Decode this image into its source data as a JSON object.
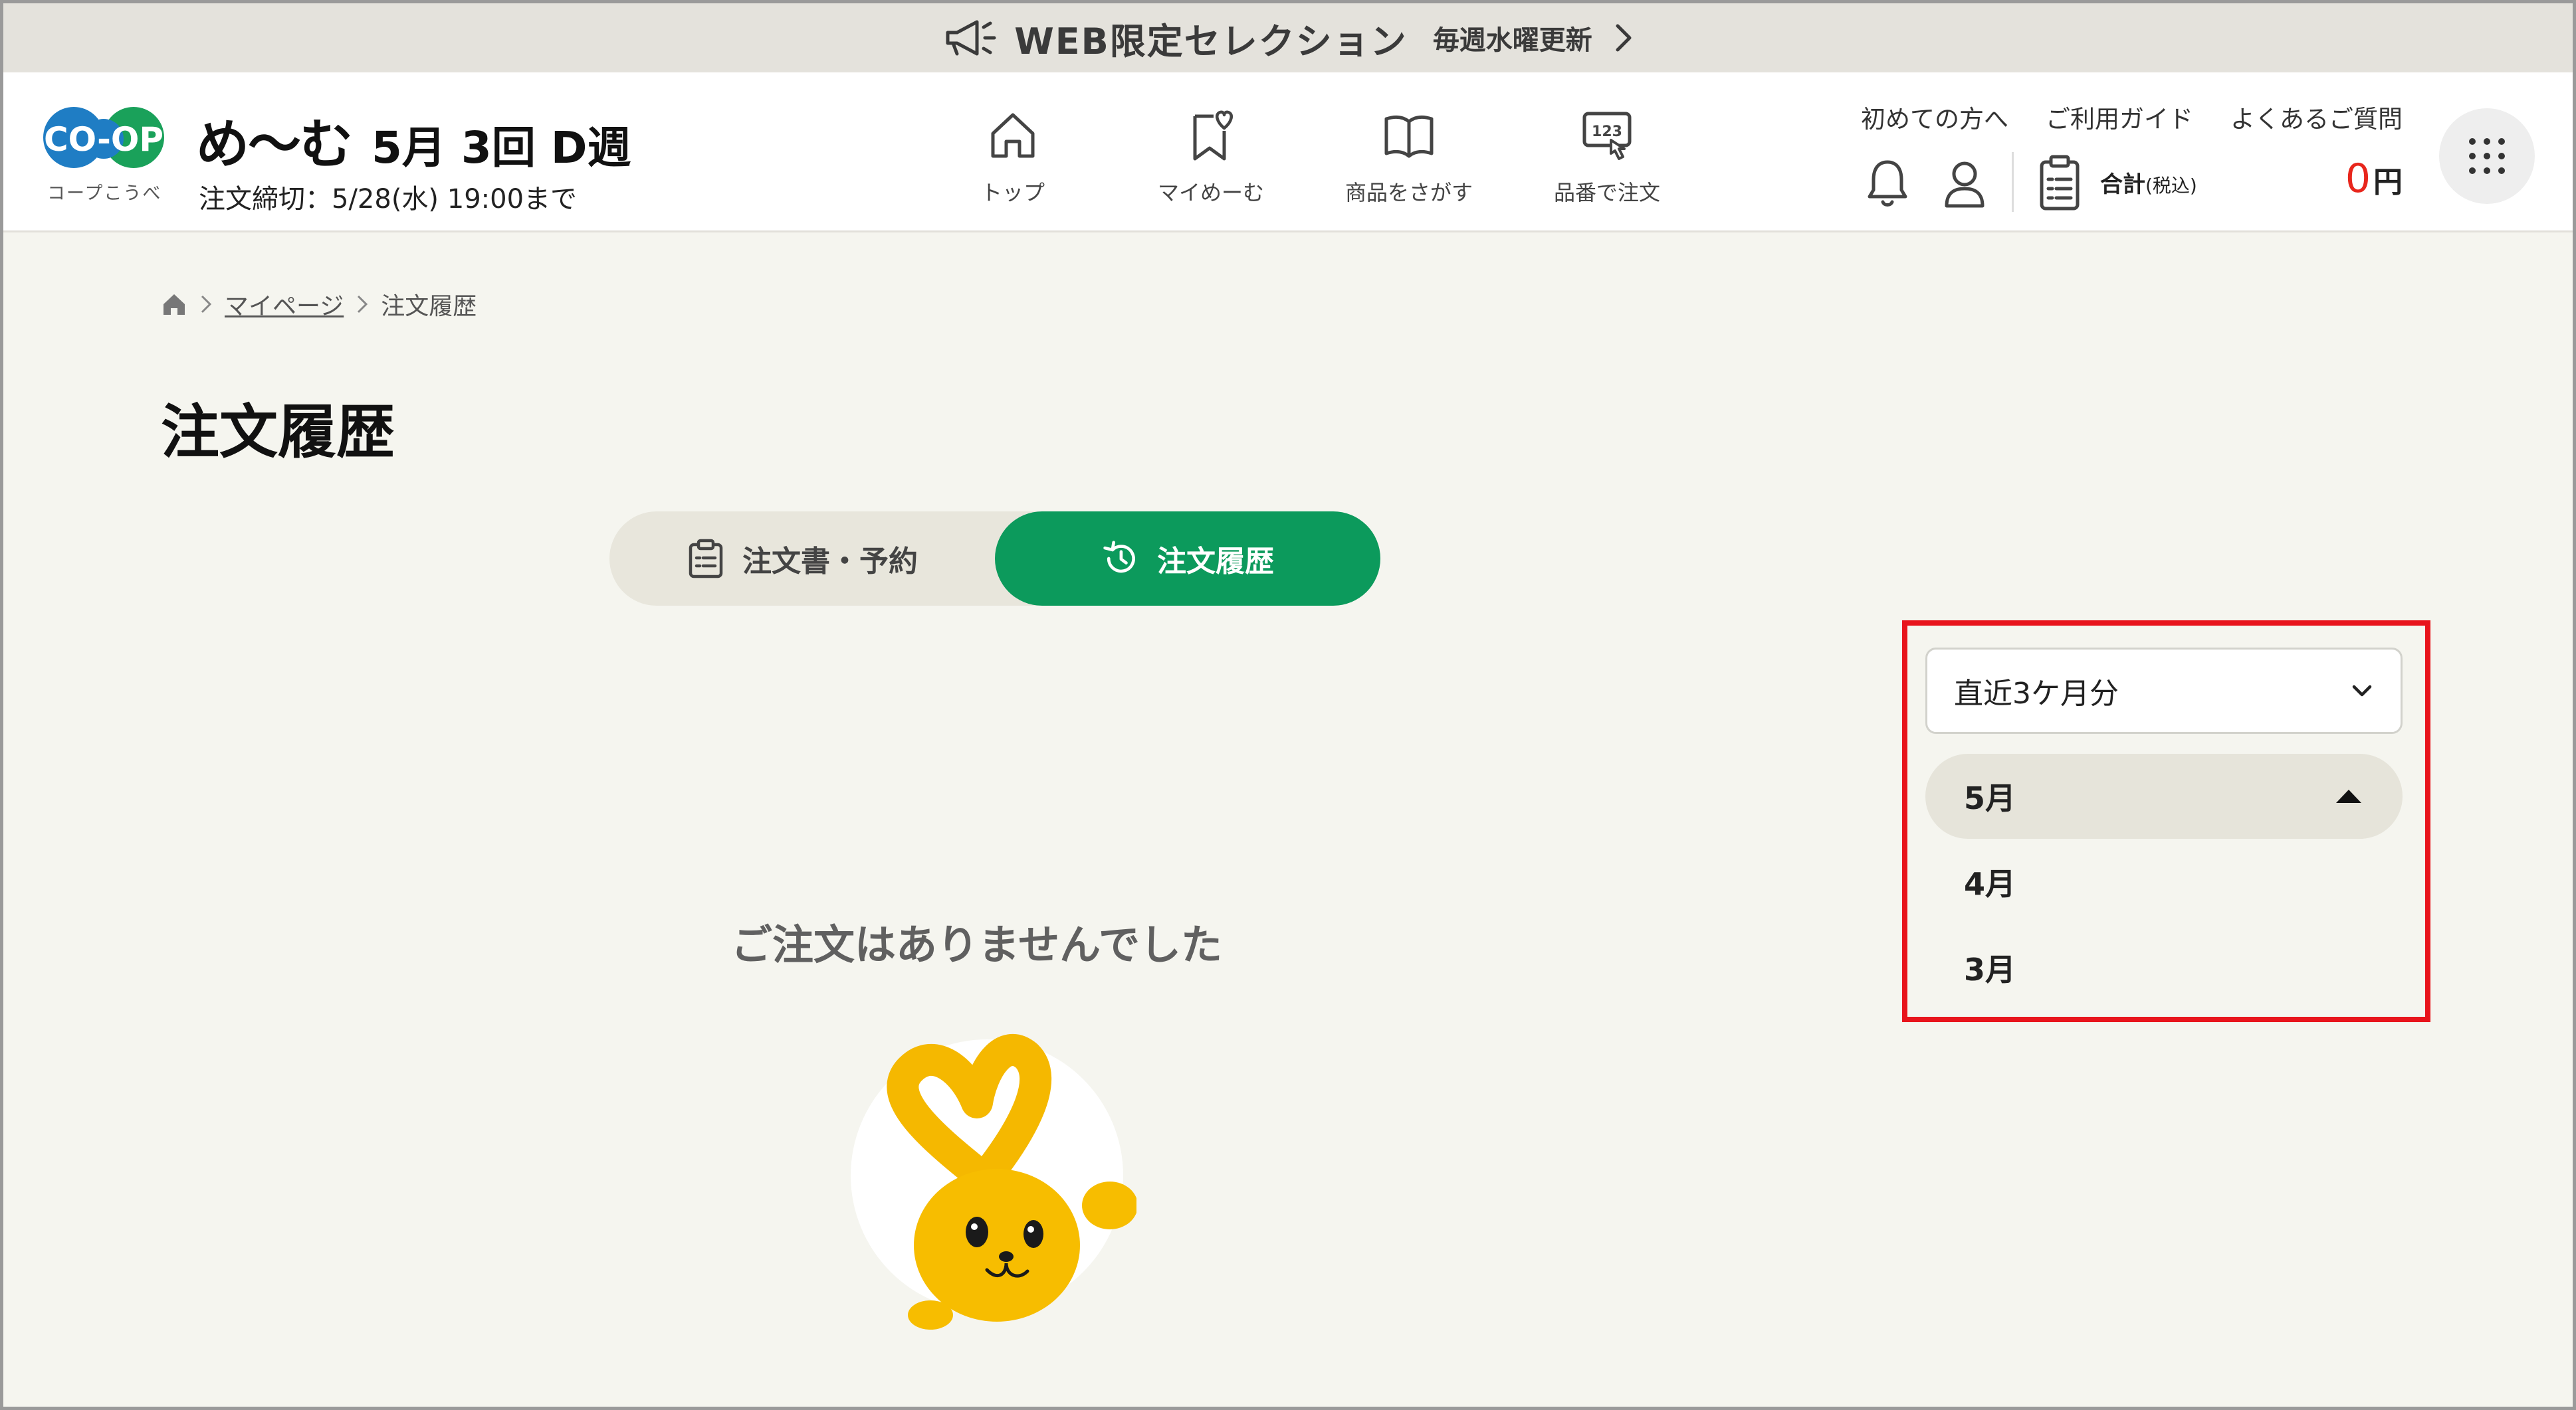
{
  "promo": {
    "title": "WEB限定セレクション",
    "subtitle": "毎週水曜更新"
  },
  "header": {
    "logo_text": "CO-OP",
    "logo_sub": "コープこうべ",
    "brand_name": "め〜む",
    "week_info": "5月 3回 D週",
    "deadline": "注文締切：5/28(水) 19:00まで",
    "nav": [
      {
        "label": "トップ",
        "icon": "home-icon"
      },
      {
        "label": "マイめーむ",
        "icon": "bookmark-heart-icon"
      },
      {
        "label": "商品をさがす",
        "icon": "book-icon"
      },
      {
        "label": "品番で注文",
        "icon": "number-touch-icon"
      }
    ],
    "links": [
      "初めての方へ",
      "ご利用ガイド",
      "よくあるご質問"
    ],
    "total_label": "合計",
    "total_tax": "(税込)",
    "total_value": "0",
    "total_unit": "円"
  },
  "breadcrumb": {
    "items": [
      "マイページ",
      "注文履歴"
    ]
  },
  "page_title": "注文履歴",
  "tabs": [
    {
      "label": "注文書・予約",
      "active": false
    },
    {
      "label": "注文履歴",
      "active": true
    }
  ],
  "filter": {
    "selected": "直近3ケ月分",
    "options": [
      {
        "label": "5月",
        "expanded": true
      },
      {
        "label": "4月",
        "expanded": false
      },
      {
        "label": "3月",
        "expanded": false
      }
    ]
  },
  "empty_message": "ご注文はありませんでした",
  "colors": {
    "accent": "#0c9a5c",
    "highlight": "#e8141c",
    "price": "#e8261c",
    "background": "#f5f5ef"
  }
}
